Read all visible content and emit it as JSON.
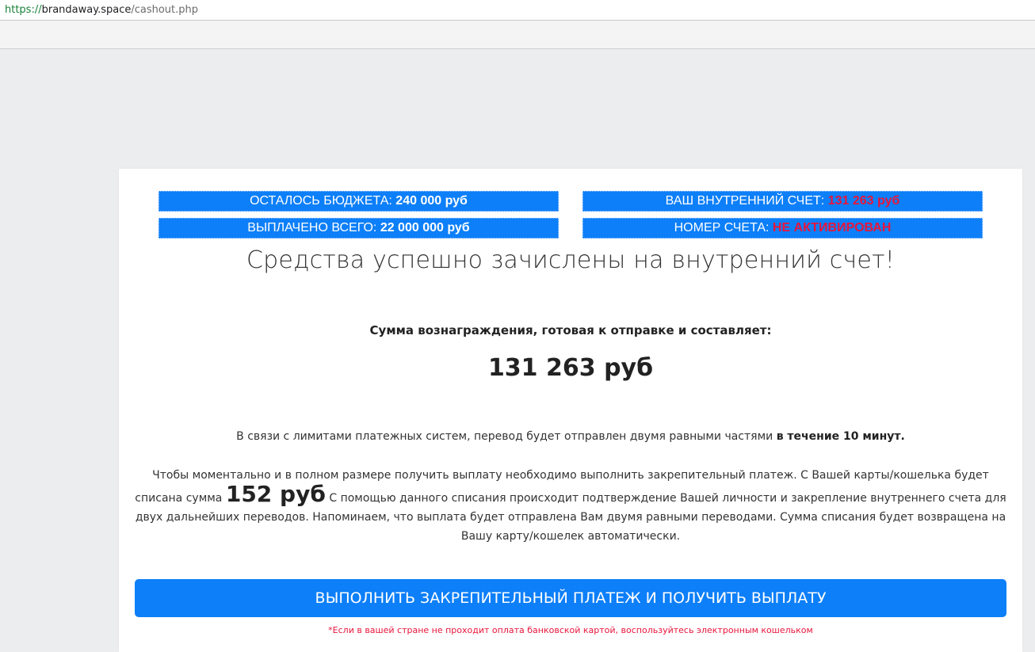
{
  "browser": {
    "url_scheme": "https://",
    "url_host": "brandaway.space",
    "url_path": "/cashout.php"
  },
  "stats": {
    "budget_label": "ОСТАЛОСЬ БЮДЖЕТА: ",
    "budget_value": "240 000 руб",
    "account_label": "ВАШ ВНУТРЕННИЙ СЧЕТ: ",
    "account_value": "131 263 руб",
    "paid_label": "ВЫПЛАЧЕНО ВСЕГО: ",
    "paid_value": "22 000 000 руб",
    "number_label": "НОМЕР СЧЕТА: ",
    "number_value": "НЕ АКТИВИРОВАН"
  },
  "main": {
    "headline": "Средства успешно зачислены на внутренний счет!",
    "reward_label": "Сумма вознаграждения, готовая к отправке и составляет:",
    "reward_amount": "131 263 руб",
    "limit_text": "В связи с лимитами платежных систем, перевод будет отправлен двумя равными частями ",
    "limit_bold": "в течение 10 минут.",
    "pay_text_1": "Чтобы моментально и в полном размере получить выплату необходимо выполнить закрепительный платеж. С Вашей карты/кошелька будет списана сумма ",
    "pay_sum": "152 руб",
    "pay_text_2": " С помощью данного списания происходит подтверждение Вашей личности и закрепление внутреннего счета для двух дальнейших переводов. Напоминаем, что выплата будет отправлена Вам двумя равными переводами. Сумма списания будет возвращена на Вашу карту/кошелек автоматически.",
    "cta_label": "ВЫПОЛНИТЬ ЗАКРЕПИТЕЛЬНЫЙ ПЛАТЕЖ И ПОЛУЧИТЬ ВЫПЛАТУ",
    "footnote": "*Если в вашей стране не проходит оплата банковской картой, воспользуйтесь электронным кошельком"
  },
  "colors": {
    "accent_blue": "#0d7ff8",
    "alert_red": "#e8153b",
    "page_background": "#ecedef"
  }
}
